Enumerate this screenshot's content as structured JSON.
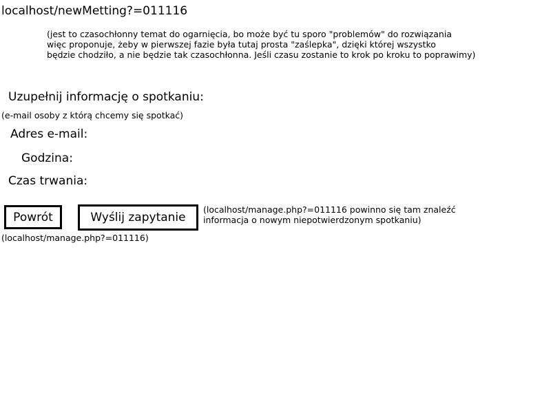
{
  "header": {
    "url": "localhost/newMetting?=011116"
  },
  "note": {
    "lines": [
      "(jest to czasochłonny temat do ogarnięcia, bo może być tu sporo \"problemów\" do rozwiązania",
      "więc proponuje, żeby w pierwszej fazie była tutaj prosta \"zaślepka\", dzięki której wszystko",
      "będzie chodziło, a nie będzie tak czasochłonna. Jeśli czasu zostanie to krok po kroku to poprawimy)"
    ]
  },
  "form": {
    "title": "Uzupełnij informację o spotkaniu:",
    "email_hint": "(e-mail osoby z którą chcemy się spotkać)",
    "email_label": "Adres e-mail:",
    "time_label": "Godzina:",
    "duration_label": "Czas trwania:"
  },
  "actions": {
    "back_label": "Powrót",
    "send_label": "Wyślij zapytanie",
    "back_target_note": "(localhost/manage.php?=011116)",
    "send_note_lines": [
      "(localhost/manage.php?=011116 powinno się tam znaleźć",
      "informacja o nowym niepotwierdzonym spotkaniu)"
    ]
  }
}
